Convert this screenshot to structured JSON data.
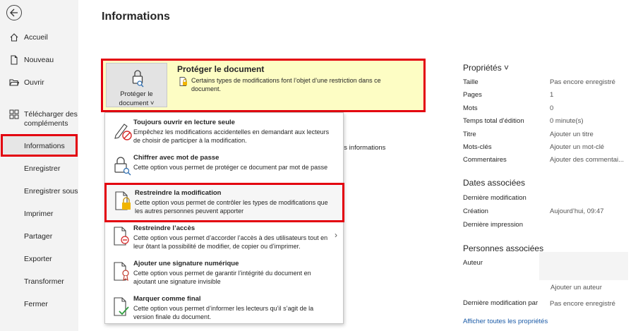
{
  "sidebar": {
    "items": [
      {
        "label": "Accueil"
      },
      {
        "label": "Nouveau"
      },
      {
        "label": "Ouvrir"
      },
      {
        "label": "Télécharger des compléments"
      },
      {
        "label": "Informations"
      },
      {
        "label": "Enregistrer"
      },
      {
        "label": "Enregistrer sous"
      },
      {
        "label": "Imprimer"
      },
      {
        "label": "Partager"
      },
      {
        "label": "Exporter"
      },
      {
        "label": "Transformer"
      },
      {
        "label": "Fermer"
      }
    ],
    "add_ins_line1": "Télécharger des",
    "add_ins_line2": "compléments"
  },
  "page": {
    "title": "Informations"
  },
  "protect": {
    "button_line1": "Protéger le",
    "button_line2": "document ˅",
    "title": "Protéger le document",
    "description": "Certains types de modifications font l’objet d’une restriction dans ce document."
  },
  "background_text": "es informations",
  "menu": {
    "items": [
      {
        "title": "Toujours ouvrir en lecture seule",
        "desc": "Empêchez les modifications accidentelles en demandant aux lecteurs de choisir de participer à la modification.",
        "icon": "pencil-no-icon"
      },
      {
        "title": "Chiffrer avec mot de passe",
        "desc": "Cette option vous permet de protéger ce document par mot de passe",
        "icon": "lock-key-icon"
      },
      {
        "title": "Restreindre la modification",
        "desc": "Cette option vous permet de contrôler les types de modifications que les autres personnes peuvent apporter",
        "icon": "document-lock-icon"
      },
      {
        "title": "Restreindre l’accès",
        "desc": "Cette option vous permet d’accorder l’accès à des utilisateurs tout en leur ôtant la possibilité de modifier, de copier ou d’imprimer.",
        "icon": "document-restrict-icon"
      },
      {
        "title": "Ajouter une signature numérique",
        "desc": "Cette option vous permet de garantir l’intégrité du document en ajoutant une signature invisible",
        "icon": "document-ribbon-icon"
      },
      {
        "title": "Marquer comme final",
        "desc": "Cette option vous permet d’informer les lecteurs qu’il s’agit de la version finale du document.",
        "icon": "document-check-icon"
      }
    ]
  },
  "properties": {
    "title": "Propriétés ˅",
    "rows": [
      {
        "key": "Taille",
        "value": "Pas encore enregistré"
      },
      {
        "key": "Pages",
        "value": "1"
      },
      {
        "key": "Mots",
        "value": "0"
      },
      {
        "key": "Temps total d’édition",
        "value": "0 minute(s)"
      },
      {
        "key": "Titre",
        "value": "Ajouter un titre"
      },
      {
        "key": "Mots-clés",
        "value": "Ajouter un mot-clé"
      },
      {
        "key": "Commentaires",
        "value": "Ajouter des commentai..."
      }
    ]
  },
  "dates": {
    "title": "Dates associées",
    "rows": [
      {
        "key": "Dernière modification",
        "value": ""
      },
      {
        "key": "Création",
        "value": "Aujourd’hui, 09:47"
      },
      {
        "key": "Dernière impression",
        "value": ""
      }
    ]
  },
  "people": {
    "title": "Personnes associées",
    "author_key": "Auteur",
    "add_author": "Ajouter un auteur",
    "last_modified_by_key": "Dernière modification par",
    "last_modified_by_value": "Pas encore enregistré"
  },
  "show_all_link": "Afficher toutes les propriétés",
  "colors": {
    "highlight": "#e3000f",
    "banner": "#fdfdc4",
    "link": "#1a5aa6"
  }
}
